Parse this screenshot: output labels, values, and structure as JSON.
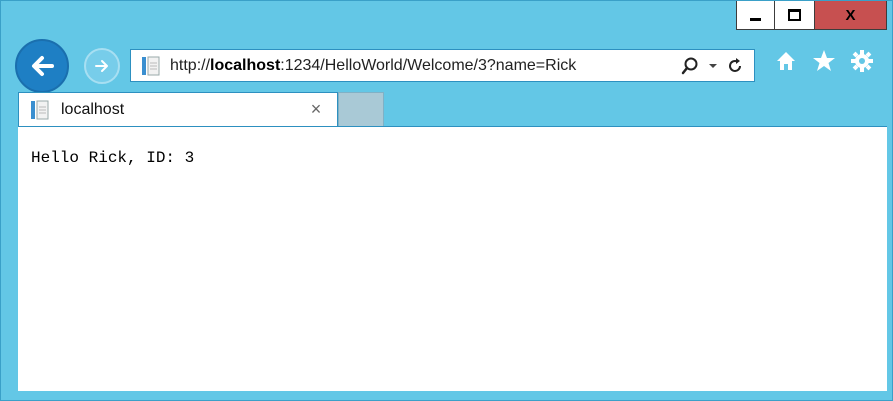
{
  "window": {
    "caption": {
      "minimize": "minimize",
      "maximize": "maximize",
      "close_label": "X"
    }
  },
  "nav": {
    "url_prefix": "http://",
    "url_host": "localhost",
    "url_rest": ":1234/HelloWorld/Welcome/3?name=Rick",
    "icons": [
      "back-icon",
      "forward-icon",
      "page-icon",
      "search-icon",
      "dropdown-icon",
      "refresh-icon",
      "home-icon",
      "favorites-icon",
      "settings-icon"
    ]
  },
  "tabs": [
    {
      "title": "localhost",
      "close": "×"
    }
  ],
  "content": {
    "text": "Hello Rick, ID: 3"
  },
  "colors": {
    "frame": "#63c7e6",
    "back_button": "#1e7fc4",
    "close_button": "#c75050"
  }
}
